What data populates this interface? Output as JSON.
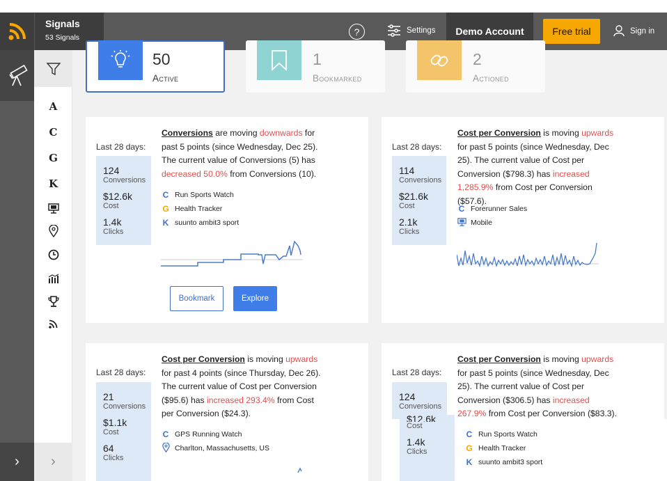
{
  "header": {
    "signals_title": "Signals",
    "signals_count": "53 Signals",
    "settings_label": "Settings",
    "demo_account": "Demo Account",
    "free_trial": "Free trial",
    "sign_in": "Sign in",
    "help_label": "?"
  },
  "sidebar": {
    "items": [
      {
        "icon": "A",
        "name": "sidebar-item-a"
      },
      {
        "icon": "C",
        "name": "sidebar-item-c"
      },
      {
        "icon": "G",
        "name": "sidebar-item-g"
      },
      {
        "icon": "K",
        "name": "sidebar-item-k"
      }
    ],
    "expand_glyph": "›"
  },
  "stats": [
    {
      "value": "50",
      "label": "Active"
    },
    {
      "value": "1",
      "label": "Bookmarked"
    },
    {
      "value": "2",
      "label": "Actioned"
    }
  ],
  "colors": {
    "accent_blue": "#3f6fc7",
    "active_tile": "#3f7de8",
    "bookmark_tile": "#8fd4d2",
    "action_tile": "#f3c46a",
    "brand_orange": "#f7a800",
    "down_red": "#e0504e"
  },
  "cards": [
    {
      "period": "Last 28 days:",
      "metrics": [
        {
          "value": "124",
          "label": "Conversions"
        },
        {
          "value": "$12.6k",
          "label": "Cost"
        },
        {
          "value": "1.4k",
          "label": "Clicks"
        }
      ],
      "metric": "Conversions",
      "t1": " are moving ",
      "direction": "downwards",
      "t2": " for past 5 points (since Wednesday, Dec 25). The current value of Conversions (5) has ",
      "change": "decreased 50.0%",
      "t3": " from Conversions (10).",
      "tags": [
        "Run Sports Watch",
        "Health Tracker",
        "suunto ambit3 sport"
      ],
      "bookmark": "Bookmark",
      "explore": "Explore"
    },
    {
      "period": "Last 28 days:",
      "metrics": [
        {
          "value": "114",
          "label": "Conversions"
        },
        {
          "value": "$21.6k",
          "label": "Cost"
        },
        {
          "value": "2.1k",
          "label": "Clicks"
        }
      ],
      "metric": "Cost per Conversion",
      "t1": " is moving ",
      "direction": "upwards",
      "t2": " for past 5 points (since Wednesday, Dec 25). The current value of Cost per Conversion ($798.3) has ",
      "change": "increased 1,285.9%",
      "t3": " from Cost per Conversion ($57.6).",
      "tags": [
        "Forerunner Sales",
        "Mobile"
      ]
    },
    {
      "period": "Last 28 days:",
      "metrics": [
        {
          "value": "21",
          "label": "Conversions"
        },
        {
          "value": "$1.1k",
          "label": "Cost"
        },
        {
          "value": "64",
          "label": "Clicks"
        }
      ],
      "metric": "Cost per Conversion",
      "t1": " is moving ",
      "direction": "upwards",
      "t2": " for past 4 points (since Thursday, Dec 26). The current value of Cost per Conversion ($95.6) has ",
      "change": "increased 293.4%",
      "t3": " from Cost per Conversion ($24.3).",
      "tags": [
        "GPS Running Watch",
        "Charlton, Massachusetts, US"
      ]
    },
    {
      "period": "Last 28 days:",
      "metrics": [
        {
          "value": "124",
          "label": "Conversions"
        },
        {
          "value": "$12.6k",
          "label": "Cost"
        },
        {
          "value": "1.4k",
          "label": "Clicks"
        }
      ],
      "metric": "Cost per Conversion",
      "t1": " is moving ",
      "direction": "upwards",
      "t2": " for past 5 points (since Wednesday, Dec 25). The current value of Cost per Conversion ($306.5) has ",
      "change": "increased 267.9%",
      "t3": " from Cost per Conversion ($83.3).",
      "tags": [
        "Run Sports Watch",
        "Health Tracker",
        "suunto ambit3 sport"
      ]
    }
  ]
}
